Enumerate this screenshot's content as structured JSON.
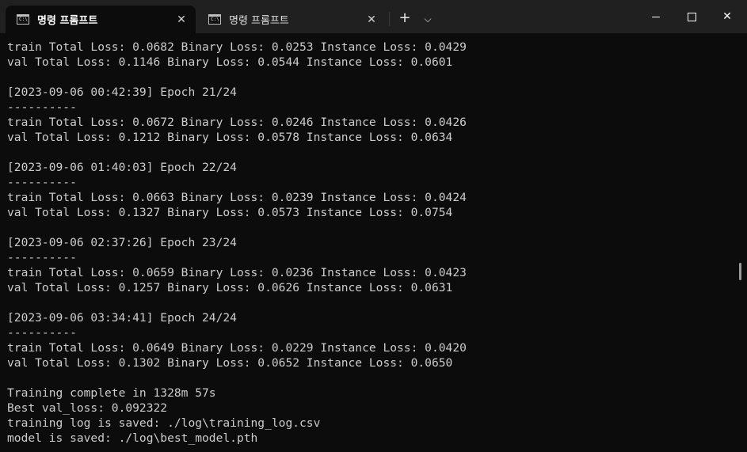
{
  "tabs": [
    {
      "label": "명령 프롬프트",
      "active": true,
      "icon": "cmd-icon",
      "close": "✕"
    },
    {
      "label": "명령 프롬프트",
      "active": false,
      "icon": "cmd-icon",
      "close": "✕"
    }
  ],
  "toolbar": {
    "new_tab": "+",
    "dropdown": "⌵"
  },
  "window_controls": {
    "minimize": "minimize-icon",
    "maximize": "maximize-icon",
    "close": "✕"
  },
  "terminal": {
    "lines": [
      "train Total Loss: 0.0682 Binary Loss: 0.0253 Instance Loss: 0.0429",
      "val Total Loss: 0.1146 Binary Loss: 0.0544 Instance Loss: 0.0601",
      "",
      "[2023-09-06 00:42:39] Epoch 21/24",
      "----------",
      "train Total Loss: 0.0672 Binary Loss: 0.0246 Instance Loss: 0.0426",
      "val Total Loss: 0.1212 Binary Loss: 0.0578 Instance Loss: 0.0634",
      "",
      "[2023-09-06 01:40:03] Epoch 22/24",
      "----------",
      "train Total Loss: 0.0663 Binary Loss: 0.0239 Instance Loss: 0.0424",
      "val Total Loss: 0.1327 Binary Loss: 0.0573 Instance Loss: 0.0754",
      "",
      "[2023-09-06 02:37:26] Epoch 23/24",
      "----------",
      "train Total Loss: 0.0659 Binary Loss: 0.0236 Instance Loss: 0.0423",
      "val Total Loss: 0.1257 Binary Loss: 0.0626 Instance Loss: 0.0631",
      "",
      "[2023-09-06 03:34:41] Epoch 24/24",
      "----------",
      "train Total Loss: 0.0649 Binary Loss: 0.0229 Instance Loss: 0.0420",
      "val Total Loss: 0.1302 Binary Loss: 0.0652 Instance Loss: 0.0650",
      "",
      "Training complete in 1328m 57s",
      "Best val_loss: 0.092322",
      "training log is saved: ./log\\training_log.csv",
      "model is saved: ./log\\best_model.pth"
    ]
  },
  "colors": {
    "background": "#0c0c0c",
    "titlebar": "#202020",
    "text": "#cccccc"
  }
}
